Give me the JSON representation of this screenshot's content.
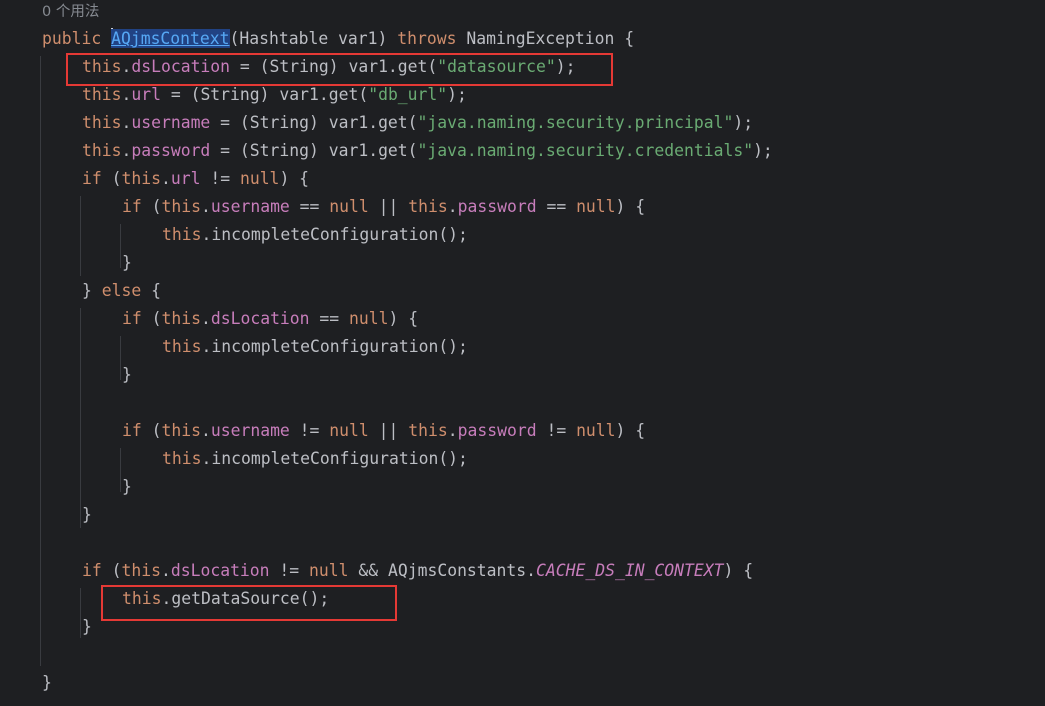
{
  "editor": {
    "usage_hint": "0 个用法",
    "colors": {
      "background": "#1e1f22",
      "keyword": "#cf8e6d",
      "field": "#c77dbb",
      "string": "#6aab73",
      "declaration": "#56a8f5",
      "annotation_box": "#e53935"
    },
    "lines": {
      "l1": {
        "kw": "public",
        "name": "AQjmsContext",
        "rest1": "(Hashtable var1) ",
        "kw2": "throws",
        "rest2": " NamingException {"
      },
      "l2": {
        "a": "this",
        "b": ".",
        "c": "dsLocation",
        "d": " = (String) var1.get(",
        "e": "\"datasource\"",
        "f": ");"
      },
      "l3": {
        "a": "this",
        "b": ".",
        "c": "url",
        "d": " = (String) var1.get(",
        "e": "\"db_url\"",
        "f": ");"
      },
      "l4": {
        "a": "this",
        "b": ".",
        "c": "username",
        "d": " = (String) var1.get(",
        "e": "\"java.naming.security.principal\"",
        "f": ");"
      },
      "l5": {
        "a": "this",
        "b": ".",
        "c": "password",
        "d": " = (String) var1.get(",
        "e": "\"java.naming.security.credentials\"",
        "f": ");"
      },
      "l6": {
        "a": "if",
        "b": " (",
        "c": "this",
        "d": ".",
        "e": "url",
        "f": " != ",
        "g": "null",
        "h": ") {"
      },
      "l7": {
        "a": "if",
        "b": " (",
        "c": "this",
        "d": ".",
        "e": "username",
        "f": " == ",
        "g": "null",
        "h": " || ",
        "i": "this",
        "j": ".",
        "k": "password",
        "l": " == ",
        "m": "null",
        "n": ") {"
      },
      "l8": {
        "a": "this",
        "b": ".incompleteConfiguration();"
      },
      "l9": {
        "a": "}"
      },
      "l10": {
        "a": "} ",
        "b": "else",
        "c": " {"
      },
      "l11": {
        "a": "if",
        "b": " (",
        "c": "this",
        "d": ".",
        "e": "dsLocation",
        "f": " == ",
        "g": "null",
        "h": ") {"
      },
      "l12": {
        "a": "this",
        "b": ".incompleteConfiguration();"
      },
      "l13": {
        "a": "}"
      },
      "l14": {
        "a": "if",
        "b": " (",
        "c": "this",
        "d": ".",
        "e": "username",
        "f": " != ",
        "g": "null",
        "h": " || ",
        "i": "this",
        "j": ".",
        "k": "password",
        "l": " != ",
        "m": "null",
        "n": ") {"
      },
      "l15": {
        "a": "this",
        "b": ".incompleteConfiguration();"
      },
      "l16": {
        "a": "}"
      },
      "l17": {
        "a": "}"
      },
      "l18": {
        "a": "if",
        "b": " (",
        "c": "this",
        "d": ".",
        "e": "dsLocation",
        "f": " != ",
        "g": "null",
        "h": " && AQjmsConstants.",
        "i": "CACHE_DS_IN_CONTEXT",
        "j": ") {"
      },
      "l19": {
        "a": "this",
        "b": ".getDataSource();"
      },
      "l20": {
        "a": "}"
      },
      "l21": {
        "a": "}"
      }
    }
  }
}
